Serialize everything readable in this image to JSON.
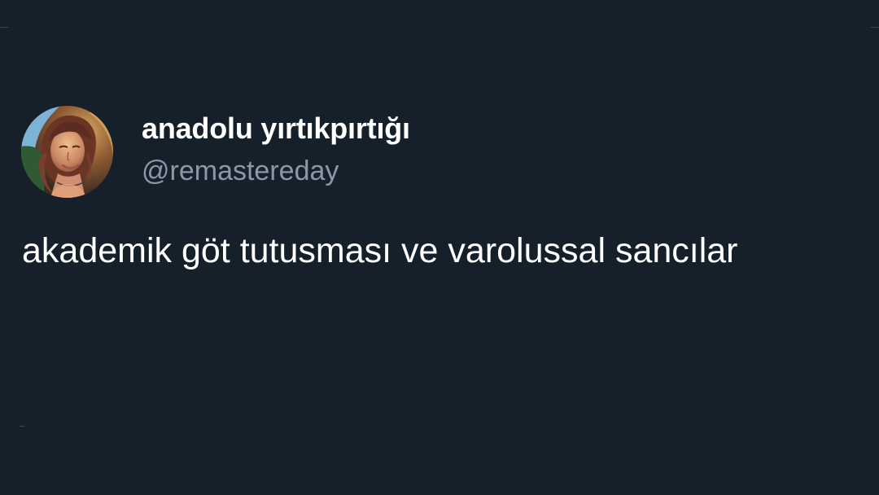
{
  "tweet": {
    "author": {
      "display_name": "anadolu yırtıkpırtığı",
      "handle": "@remastereday",
      "avatar_icon": "profile-photo"
    },
    "text": "akademik göt tutusması ve varolussal sancılar"
  },
  "colors": {
    "background": "#16202a",
    "text_primary": "#ffffff",
    "text_secondary": "#8b98a5"
  }
}
